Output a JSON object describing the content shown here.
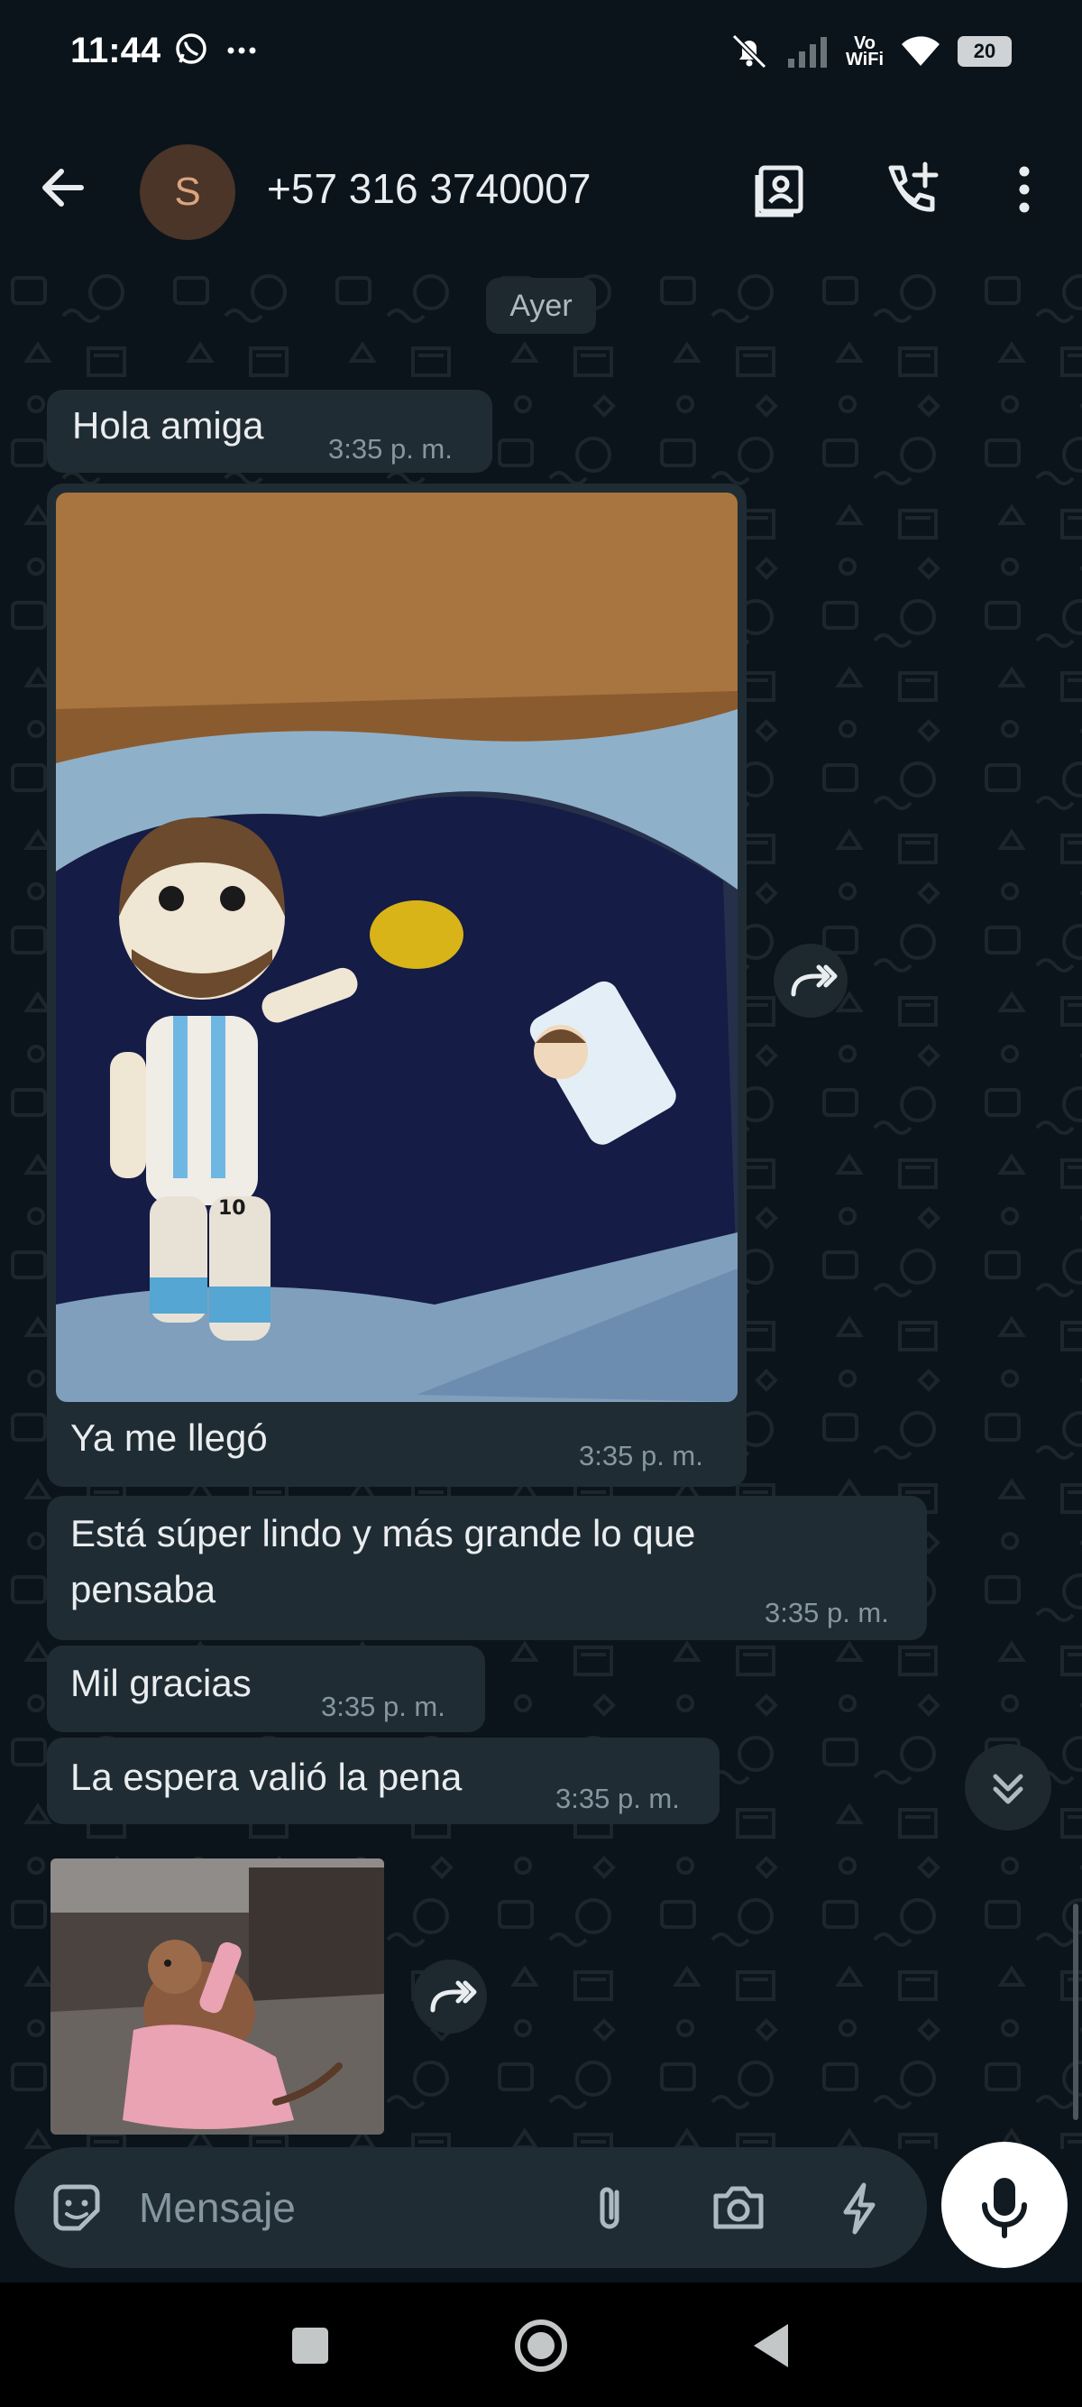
{
  "status_bar": {
    "time": "11:44",
    "battery": "20",
    "vowifi_top": "Vo",
    "vowifi_bottom": "WiFi"
  },
  "header": {
    "avatar_letter": "S",
    "contact_name": "+57 316 3740007"
  },
  "chat": {
    "date_separator": "Ayer",
    "messages": [
      {
        "text": "Hola amiga",
        "time": "3:35 p. m."
      },
      {
        "text": "Ya me llegó",
        "time": "3:35 p. m.",
        "has_image": true,
        "image_desc": "crochet-doll-photo"
      },
      {
        "text_line1": "Está súper lindo y más grande lo que",
        "text_line2": "pensaba",
        "time": "3:35 p. m."
      },
      {
        "text": "Mil gracias",
        "time": "3:35 p. m."
      },
      {
        "text": "La espera valió la pena",
        "time": "3:35 p. m."
      },
      {
        "sticker": "monkey-in-pink-dress-sticker"
      }
    ]
  },
  "composer": {
    "placeholder": "Mensaje"
  },
  "colors": {
    "background": "#0b141a",
    "bubble": "#202c33",
    "accent_avatar": "#4b3428",
    "timestamp": "#8696a0"
  },
  "icons": [
    "back-arrow-icon",
    "contact-card-icon",
    "add-call-icon",
    "more-vert-icon",
    "forward-icon",
    "scroll-down-icon",
    "sticker-icon",
    "attach-icon",
    "camera-icon",
    "quick-reply-icon",
    "mic-icon"
  ]
}
